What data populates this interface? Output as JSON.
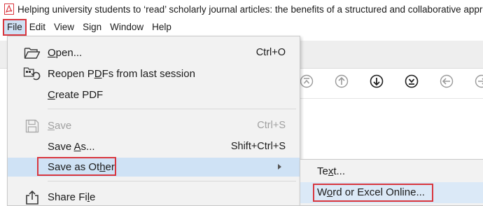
{
  "window": {
    "title": "Helping university students to ‘read’ scholarly journal articles: the benefits of a structured and collaborative approac"
  },
  "menubar": {
    "items": [
      {
        "label": "File"
      },
      {
        "label": "Edit"
      },
      {
        "label": "View"
      },
      {
        "label": "Sign"
      },
      {
        "label": "Window"
      },
      {
        "label": "Help"
      }
    ]
  },
  "file_menu": {
    "open": {
      "pre": "",
      "mn": "O",
      "post": "pen...",
      "shortcut": "Ctrl+O",
      "icon": "folder-open-icon"
    },
    "reopen": {
      "pre": "Reopen P",
      "mn": "D",
      "post": "Fs from last session",
      "icon": "reopen-pdfs-icon"
    },
    "create": {
      "pre": "",
      "mn": "C",
      "post": "reate PDF"
    },
    "save": {
      "pre": "",
      "mn": "S",
      "post": "ave",
      "shortcut": "Ctrl+S",
      "icon": "save-disk-icon",
      "disabled": true
    },
    "save_as": {
      "pre": "Save ",
      "mn": "A",
      "post": "s...",
      "shortcut": "Shift+Ctrl+S"
    },
    "save_other": {
      "pre": "Save as Ot",
      "mn": "h",
      "post": "er"
    },
    "share": {
      "pre": "Share Fi",
      "mn": "l",
      "post": "e",
      "icon": "share-upload-icon"
    }
  },
  "submenu": {
    "text": {
      "pre": "Te",
      "mn": "x",
      "post": "t..."
    },
    "word_excel": {
      "pre": "W",
      "mn": "o",
      "post": "rd or Excel Online..."
    }
  },
  "colors": {
    "accent_red": "#d9363e",
    "hover_blue": "#cfe2f5",
    "menu_bg": "#f2f2f2"
  }
}
